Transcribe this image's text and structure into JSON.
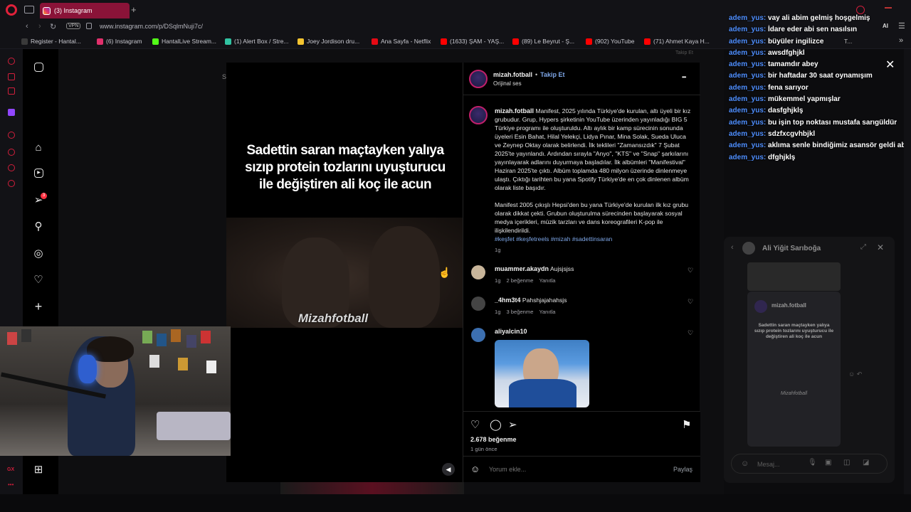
{
  "browser": {
    "tab_title": "(3) Instagram",
    "new_tab": "+",
    "vpn": "VPN",
    "url": "www.instagram.com/p/DSqlmNuji7c/",
    "bookmarks": [
      {
        "label": "Register - Hantal...",
        "color": "#3a3a3a"
      },
      {
        "label": "(6) Instagram",
        "color": "#e1306c"
      },
      {
        "label": "HantalLive Stream...",
        "color": "#53fc18"
      },
      {
        "label": "(1) Alert Box / Stre...",
        "color": "#31c3a2"
      },
      {
        "label": "Joey Jordison dru...",
        "color": "#f4c430"
      },
      {
        "label": "Ana Sayfa - Netflix",
        "color": "#e50914"
      },
      {
        "label": "(1633) ŞAM - YAŞ...",
        "color": "#ff0000"
      },
      {
        "label": "(89) Le Beyrut - Ş...",
        "color": "#ff0000"
      },
      {
        "label": "(902) YouTube",
        "color": "#ff0000"
      },
      {
        "label": "(71) Ahmet Kaya H...",
        "color": "#ff0000"
      }
    ],
    "bookmark_overflow": "T...",
    "ai_label": "AI"
  },
  "reel": {
    "caption": "Sadettin saran maçtayken yalıya sızıp protein tozlarını uyuşturucu ile değiştiren ali koç ile acun",
    "watermark": "Mizahfotball"
  },
  "post": {
    "author": "mizah.fotball",
    "follow": "Takip Et",
    "bullet": "•",
    "audio": "Orijinal ses",
    "more": "•••",
    "caption_p1": "Manifest, 2025 yılında Türkiye'de kurulan, altı üyeli bir kız grubudur. Grup, Hypers şirketinin YouTube üzerinden yayınladığı BIG 5 Türkiye programı ile oluşturuldu. Altı aylık bir kamp sürecinin sonunda üyeleri Esin Bahat, Hilal Yelekçi, Lidya Pınar, Mina Solak, Sueda Uluca ve Zeynep Oktay olarak belirlendi. İlk teklileri \"Zamansızdık\" 7 Şubat 2025'te yayınlandı. Ardından sırayla \"Anyo\", \"KTS\" ve \"Snap\" şarkılarını yayınlayarak adlarını duyurmaya başladılar. İlk albümleri \"Manifestival\" Haziran 2025'te çıktı. Albüm toplamda 480 milyon üzerinde dinlenmeye ulaştı. Çıktığı tarihten bu yana Spotify Türkiye'de en çok dinlenen albüm olarak liste başıdır.",
    "caption_p2": "Manifest 2005 çıkışlı Hepsi'den bu yana Türkiye'de kurulan ilk kız grubu olarak dikkat çekti. Grubun oluşturulma sürecinden başlayarak sosyal medya içerikleri, müzik tarzları ve dans koreografileri K-pop ile ilişkilendirildi.",
    "hashtags": "#keşfet #keşfetreels #mizah #sadettinsaran",
    "caption_time": "1g",
    "comments": [
      {
        "user": "muammer.akaydn",
        "text": "Aujsjsjss",
        "time": "1g",
        "likes": "2 beğenme",
        "reply": "Yanıtla"
      },
      {
        "user": "_4hm3t4",
        "text": "Pahshjajahahsjs",
        "time": "1g",
        "likes": "3 beğenme",
        "reply": "Yanıtla"
      },
      {
        "user": "aliyalcin10",
        "text": "",
        "time": "",
        "likes": "",
        "reply": ""
      }
    ],
    "likes_count": "2.678 beğenme",
    "posted": "1 gün önce",
    "comment_placeholder": "Yorum ekle...",
    "share": "Paylaş"
  },
  "chat": {
    "lines": [
      {
        "user": "adem_yus:",
        "msg": "vay ali abim gelmiş hoşgelmiş"
      },
      {
        "user": "adem_yus:",
        "msg": "İdare eder abi sen nasılsın"
      },
      {
        "user": "adem_yus:",
        "msg": "büyüler ingilizce"
      },
      {
        "user": "adem_yus:",
        "msg": "awsdfghjkl"
      },
      {
        "user": "adem_yus:",
        "msg": "tamamdır abey"
      },
      {
        "user": "adem_yus:",
        "msg": "bir haftadar 30 saat oynamışım"
      },
      {
        "user": "adem_yus:",
        "msg": "fena sarıyor"
      },
      {
        "user": "adem_yus:",
        "msg": "mükemmel yapmışlar"
      },
      {
        "user": "adem_yus:",
        "msg": "dasfghjklş"
      },
      {
        "user": "adem_yus:",
        "msg": "bu işin top noktası mustafa sarıgüldür"
      },
      {
        "user": "adem_yus:",
        "msg": "sdzfxcgvhbjkl"
      },
      {
        "user": "adem_yus:",
        "msg": "aklıma senle bindiğimiz asansör geldi abi"
      },
      {
        "user": "adem_yus:",
        "msg": "dfghjklş"
      }
    ]
  },
  "dm": {
    "contact": "Ali Yiğit Sarıboğa",
    "shared_author": "mizah.fotball",
    "shared_caption": "Sadettin saran maçtayken yalıya sızıp protein tozlarını uyuşturucu ile değiştiren ali koç ile acun",
    "shared_watermark": "Mizahfotball",
    "message_placeholder": "Mesaj..."
  },
  "overlay_fragments": {
    "left_letter": "S",
    "top_right": "Takip Et",
    "bottom_left": "GX"
  },
  "notification_badge": "3"
}
